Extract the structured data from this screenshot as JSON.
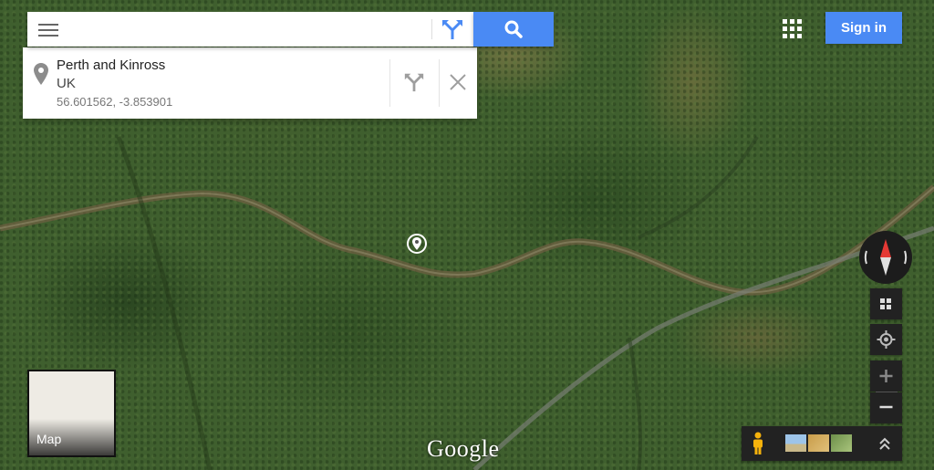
{
  "search": {
    "value": "",
    "placeholder": ""
  },
  "result_card": {
    "title": "Perth and Kinross",
    "subtitle": "UK",
    "coordinates": "56.601562, -3.853901"
  },
  "header": {
    "sign_in_label": "Sign in"
  },
  "map_thumbnail": {
    "label": "Map"
  },
  "logo": "Google",
  "icons": {
    "menu": "menu-icon",
    "directions": "directions-icon",
    "search": "search-icon",
    "pin": "place-pin-icon",
    "close": "close-icon",
    "apps": "apps-grid-icon",
    "compass": "compass-icon",
    "tilt": "tilt-icon",
    "locate": "my-location-icon",
    "zoom_in": "zoom-in-icon",
    "zoom_out": "zoom-out-icon",
    "pegman": "pegman-icon",
    "expand": "expand-up-icon"
  },
  "colors": {
    "accent": "#4a8af4",
    "control_dark": "#222222",
    "compass_red": "#e53935"
  }
}
